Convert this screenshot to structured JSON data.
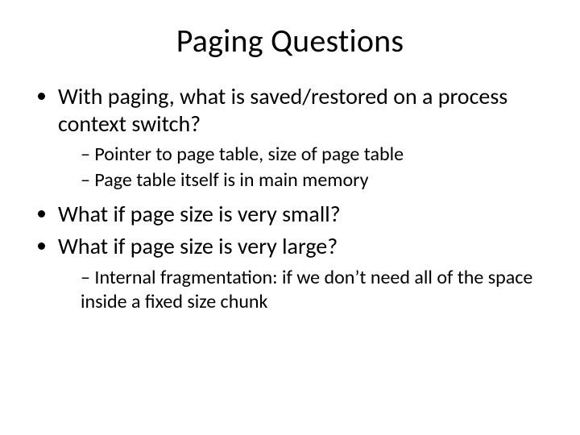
{
  "slide": {
    "title": "Paging Questions",
    "bullets": {
      "b1": "With paging, what is saved/restored on a process context switch?",
      "b1_s1": "Pointer to page table, size of page table",
      "b1_s2": "Page table itself is in main memory",
      "b2": "What if page size is very small?",
      "b3": "What if page size is very large?",
      "b3_s1": "Internal fragmentation: if we don’t need all of the space inside a fixed size chunk"
    }
  }
}
